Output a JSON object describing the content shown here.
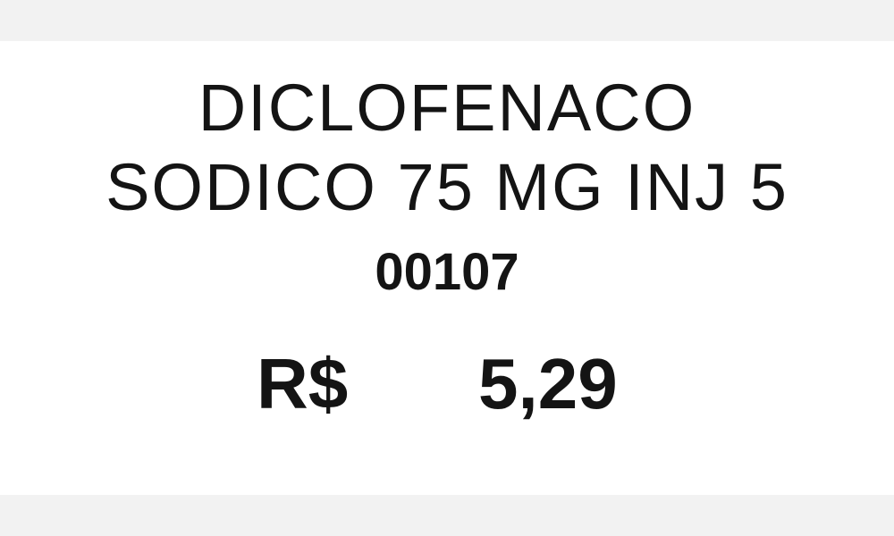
{
  "product": {
    "name_line1": "DICLOFENACO",
    "name_line2": "SODICO 75 MG INJ 5",
    "code": "00107",
    "currency": "R$",
    "price": "5,29"
  },
  "colors": {
    "text": "#141414",
    "label_background": "#ffffff",
    "page_background": "#f2f2f2"
  }
}
